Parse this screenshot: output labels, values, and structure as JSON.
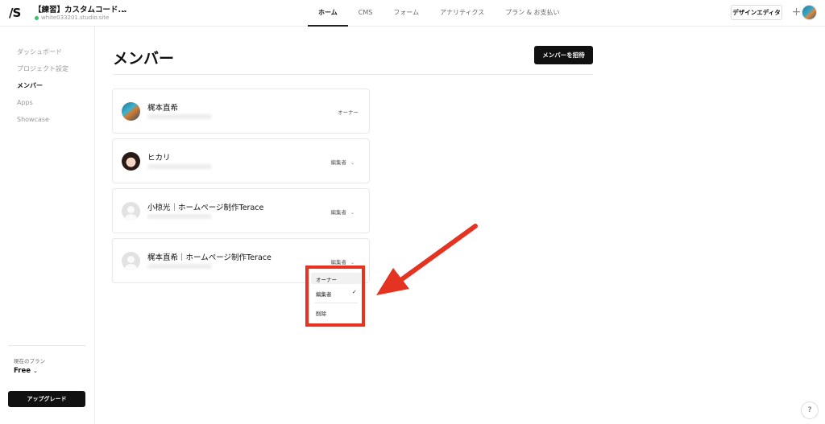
{
  "header": {
    "logo": "/S",
    "project_title": "【練習】カスタムコード...",
    "project_url": "white033201.studio.site",
    "tabs": [
      "ホーム",
      "CMS",
      "フォーム",
      "アナリティクス",
      "プラン & お支払い"
    ],
    "active_tab": "ホーム",
    "design_editor_label": "デザインエディタ",
    "plus_icon": "+"
  },
  "sidebar": {
    "items": [
      {
        "label": "ダッシュボード",
        "active": false
      },
      {
        "label": "プロジェクト設定",
        "active": false
      },
      {
        "label": "メンバー",
        "active": true
      },
      {
        "label": "Apps",
        "active": false
      },
      {
        "label": "Showcase",
        "active": false
      }
    ],
    "plan_label": "現在のプラン",
    "plan_value": "Free",
    "upgrade_label": "アップグレード"
  },
  "main": {
    "title": "メンバー",
    "invite_label": "メンバーを招待",
    "members": [
      {
        "name": "梶本直希",
        "role": "オーナー",
        "editable": false,
        "avatar": "photo1"
      },
      {
        "name": "ヒカリ",
        "role": "編集者",
        "editable": true,
        "avatar": "photo2"
      },
      {
        "name": "小椋光｜ホームページ制作Terace",
        "role": "編集者",
        "editable": true,
        "avatar": "placeholder"
      },
      {
        "name": "梶本直希｜ホームページ制作Terace",
        "role": "編集者",
        "editable": true,
        "avatar": "placeholder"
      }
    ]
  },
  "role_dropdown": {
    "options": [
      "オーナー",
      "編集者",
      "削除"
    ],
    "selected": "編集者",
    "check_icon": "✓"
  },
  "chevron_icon": "⌄",
  "help_label": "?",
  "colors": {
    "annotation_red": "#e53322",
    "primary_button": "#111111",
    "status_green": "#36c26b"
  }
}
